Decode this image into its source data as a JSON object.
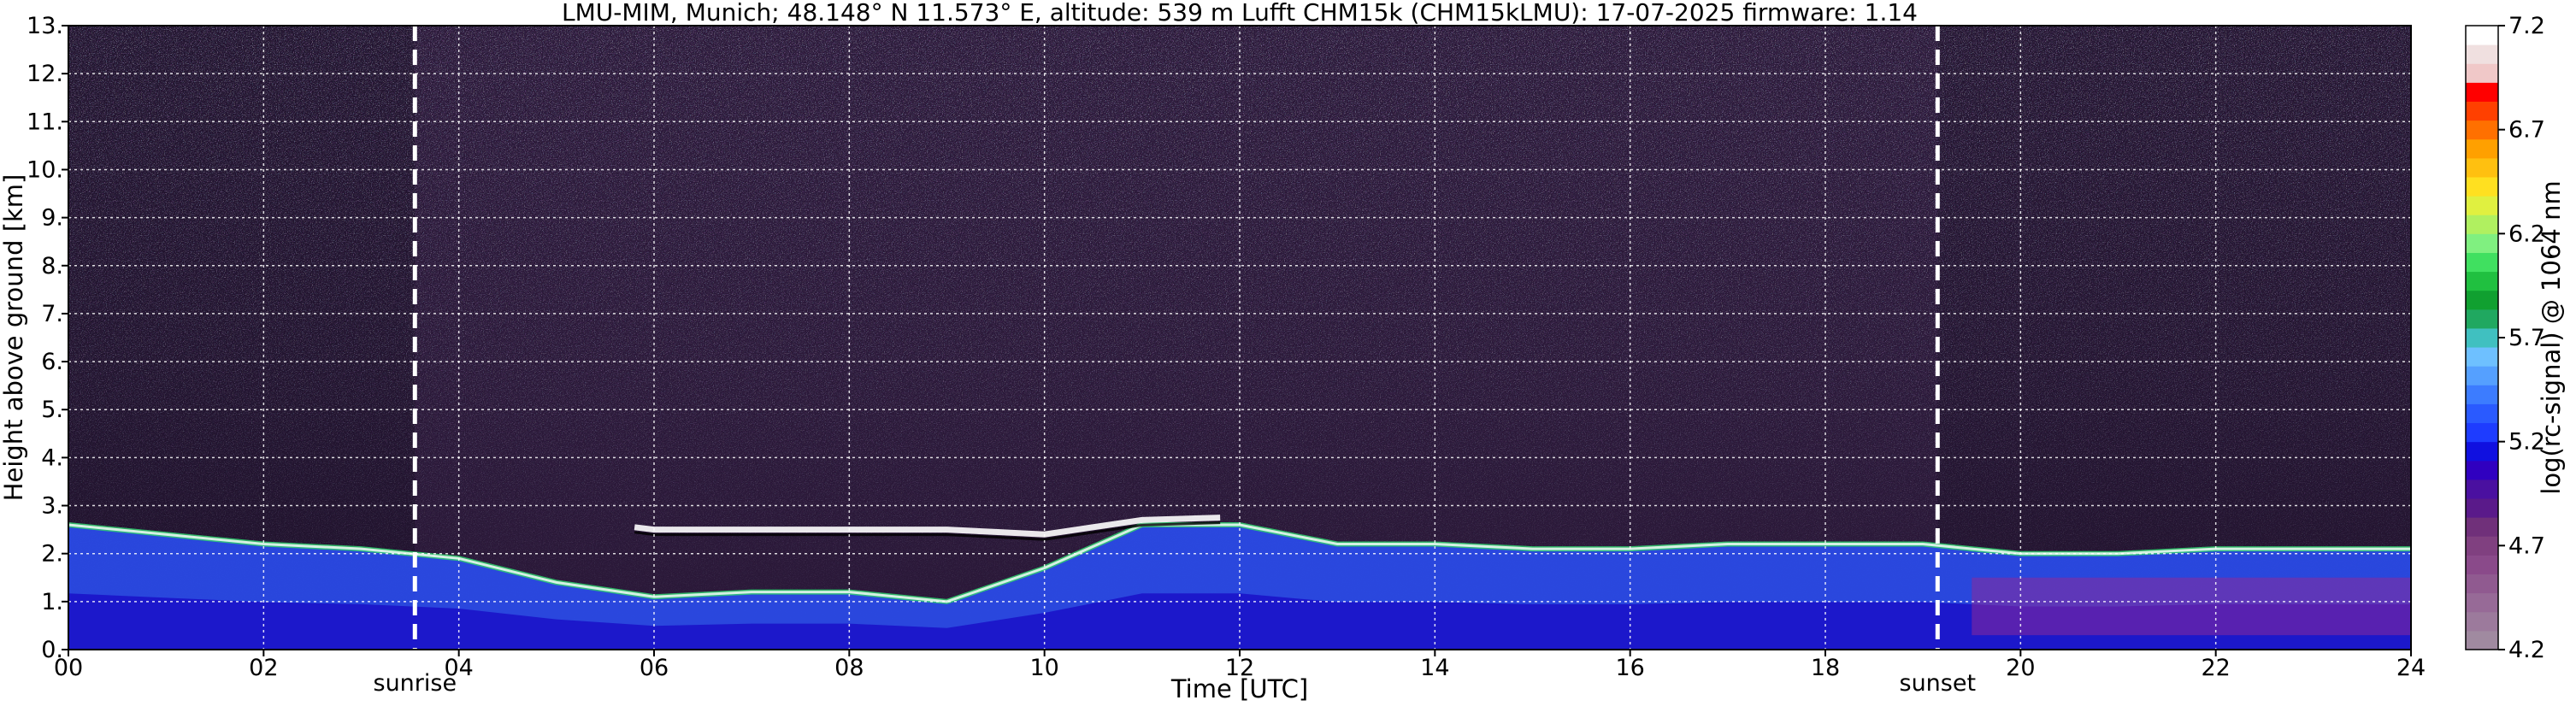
{
  "chart_data": {
    "type": "heatmap",
    "title": "LMU-MIM, Munich; 48.148° N 11.573° E, altitude: 539 m    Lufft CHM15k (CHM15kLMU): 17-07-2025    firmware: 1.14",
    "xlabel": "Time [UTC]",
    "ylabel": "Height above ground [km]",
    "xlim": [
      0,
      24
    ],
    "ylim": [
      0,
      13
    ],
    "xticks": [
      "00",
      "02",
      "04",
      "06",
      "08",
      "10",
      "12",
      "14",
      "16",
      "18",
      "20",
      "22",
      "24"
    ],
    "yticks": [
      "0.",
      "1.",
      "2.",
      "3.",
      "4.",
      "5.",
      "6.",
      "7.",
      "8.",
      "9.",
      "10.",
      "11.",
      "12.",
      "13."
    ],
    "grid": true,
    "events": [
      {
        "label": "sunrise",
        "time": 3.55
      },
      {
        "label": "sunset",
        "time": 19.15
      }
    ],
    "colorbar": {
      "label": "log(rc-signal) @ 1064 nm",
      "range": [
        4.2,
        7.2
      ],
      "ticks": [
        "4.2",
        "4.7",
        "5.2",
        "5.7",
        "6.2",
        "6.7",
        "7.2"
      ],
      "colors": [
        "#a08aa0",
        "#9c7a9c",
        "#976a97",
        "#905a90",
        "#8a4a8a",
        "#804080",
        "#70307a",
        "#5a1a8a",
        "#4a10a0",
        "#3000c0",
        "#1010e0",
        "#1e3cff",
        "#2a5aff",
        "#3c7cff",
        "#55a0ff",
        "#6ec0ff",
        "#40c0c0",
        "#20a860",
        "#10a030",
        "#20c040",
        "#40e060",
        "#80f080",
        "#b0f060",
        "#e0f040",
        "#ffe020",
        "#ffc010",
        "#ffa000",
        "#ff7000",
        "#ff4000",
        "#ff0000",
        "#f0c8c8",
        "#f0e0e0",
        "#ffffff"
      ]
    },
    "layers": [
      {
        "name": "aerosol-layer-top",
        "time": [
          0,
          1,
          2,
          3,
          4,
          5,
          6,
          7,
          8,
          9,
          10,
          11,
          12,
          13,
          14,
          15,
          16,
          17,
          18,
          19,
          20,
          21,
          22,
          23,
          24
        ],
        "height_km": [
          2.6,
          2.4,
          2.2,
          2.1,
          1.9,
          1.4,
          1.1,
          1.2,
          1.2,
          1.0,
          1.7,
          2.6,
          2.6,
          2.2,
          2.2,
          2.1,
          2.1,
          2.2,
          2.2,
          2.2,
          2.0,
          2.0,
          2.1,
          2.1,
          2.1
        ]
      },
      {
        "name": "elevated-layer",
        "time": [
          5.8,
          6,
          7,
          8,
          9,
          9.5,
          10,
          11,
          11.8
        ],
        "height_km": [
          2.55,
          2.5,
          2.5,
          2.5,
          2.5,
          2.45,
          2.4,
          2.7,
          2.75
        ]
      }
    ]
  }
}
